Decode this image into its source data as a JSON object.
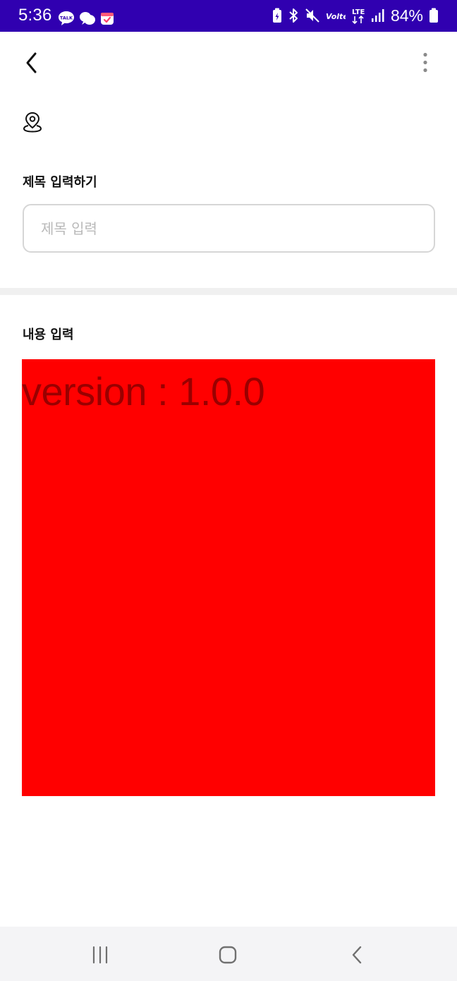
{
  "status_bar": {
    "time": "5:36",
    "battery_percent": "84%",
    "background_color": "#3000b0",
    "left_icons": [
      "kakaotalk-icon",
      "chat-bubble-icon",
      "calendar-icon"
    ],
    "right_icons": [
      "battery-saver-icon",
      "bluetooth-icon",
      "mute-icon",
      "volte-icon",
      "lte-icon",
      "signal-icon",
      "battery-icon"
    ],
    "volte_text": "Volte",
    "lte_text": "LTE",
    "talk_text": "TALK"
  },
  "app_bar": {
    "back_icon": "chevron-left-icon",
    "more_icon": "more-vertical-icon"
  },
  "location": {
    "icon": "location-pin-icon"
  },
  "title_section": {
    "label": "제목 입력하기",
    "placeholder": "제목 입력",
    "value": ""
  },
  "content_section": {
    "label": "내용 입력",
    "box_color": "#ff0000",
    "text": "version : 1.0.0"
  },
  "nav_bar": {
    "items": [
      "recents-icon",
      "home-icon",
      "back-icon"
    ]
  }
}
